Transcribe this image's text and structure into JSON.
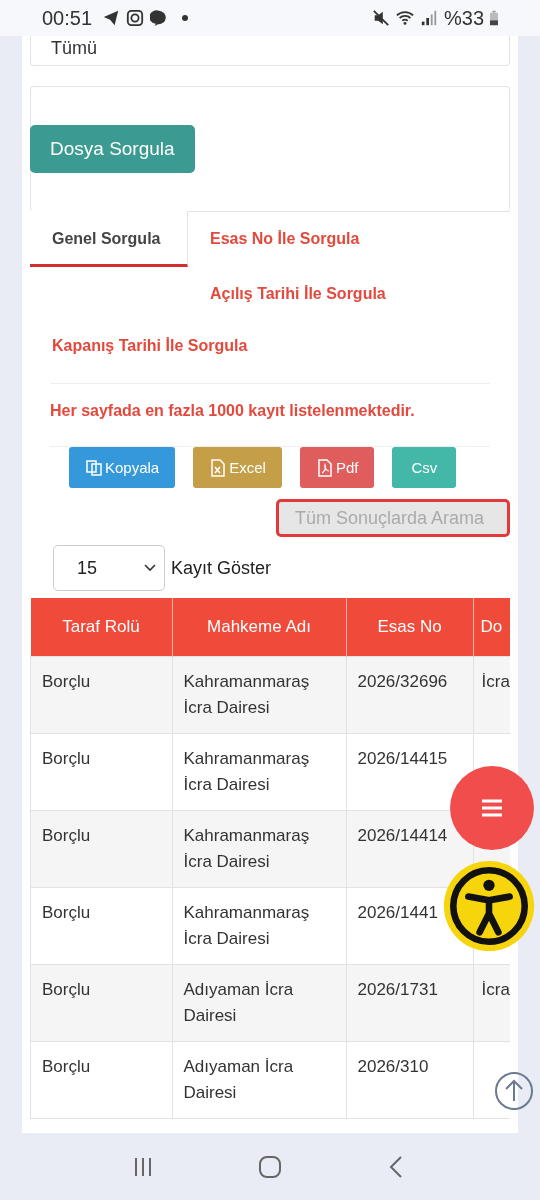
{
  "status_bar": {
    "time": "00:51",
    "battery": "%33"
  },
  "filter_field": {
    "value": "Tümü"
  },
  "query_button": "Dosya Sorgula",
  "tabs": [
    {
      "label": "Genel Sorgula",
      "selected": true
    },
    {
      "label": "Esas No İle Sorgula",
      "selected": false
    },
    {
      "label": "Açılış Tarihi İle Sorgula",
      "selected": false
    },
    {
      "label": "Kapanış Tarihi İle Sorgula",
      "selected": false
    }
  ],
  "notice": "Her sayfada en fazla 1000 kayıt listelenmektedir.",
  "export_buttons": [
    {
      "label": "Kopyala",
      "kind": "copy"
    },
    {
      "label": "Excel",
      "kind": "excel"
    },
    {
      "label": "Pdf",
      "kind": "pdf"
    },
    {
      "label": "Csv",
      "kind": "csv"
    }
  ],
  "search": {
    "placeholder": "Tüm Sonuçlarda Arama"
  },
  "page_size": {
    "value": "15",
    "label": "Kayıt Göster"
  },
  "table": {
    "columns": [
      "Taraf Rolü",
      "Mahkeme Adı",
      "Esas No",
      "Do"
    ],
    "rows": [
      {
        "role": "Borçlu",
        "court": "Kahramanmaraş İcra Dairesi",
        "case_no": "2026/32696",
        "column_4": "İcra"
      },
      {
        "role": "Borçlu",
        "court": "Kahramanmaraş İcra Dairesi",
        "case_no": "2026/14415"
      },
      {
        "role": "Borçlu",
        "court": "Kahramanmaraş İcra Dairesi",
        "case_no": "2026/14414"
      },
      {
        "role": "Borçlu",
        "court": "Kahramanmaraş İcra Dairesi",
        "case_no": "2026/1441"
      },
      {
        "role": "Borçlu",
        "court": "Adıyaman İcra Dairesi",
        "case_no": "2026/1731",
        "column_4": "İcra"
      },
      {
        "role": "Borçlu",
        "court": "Adıyaman İcra Dairesi",
        "case_no": "2026/310"
      }
    ]
  }
}
